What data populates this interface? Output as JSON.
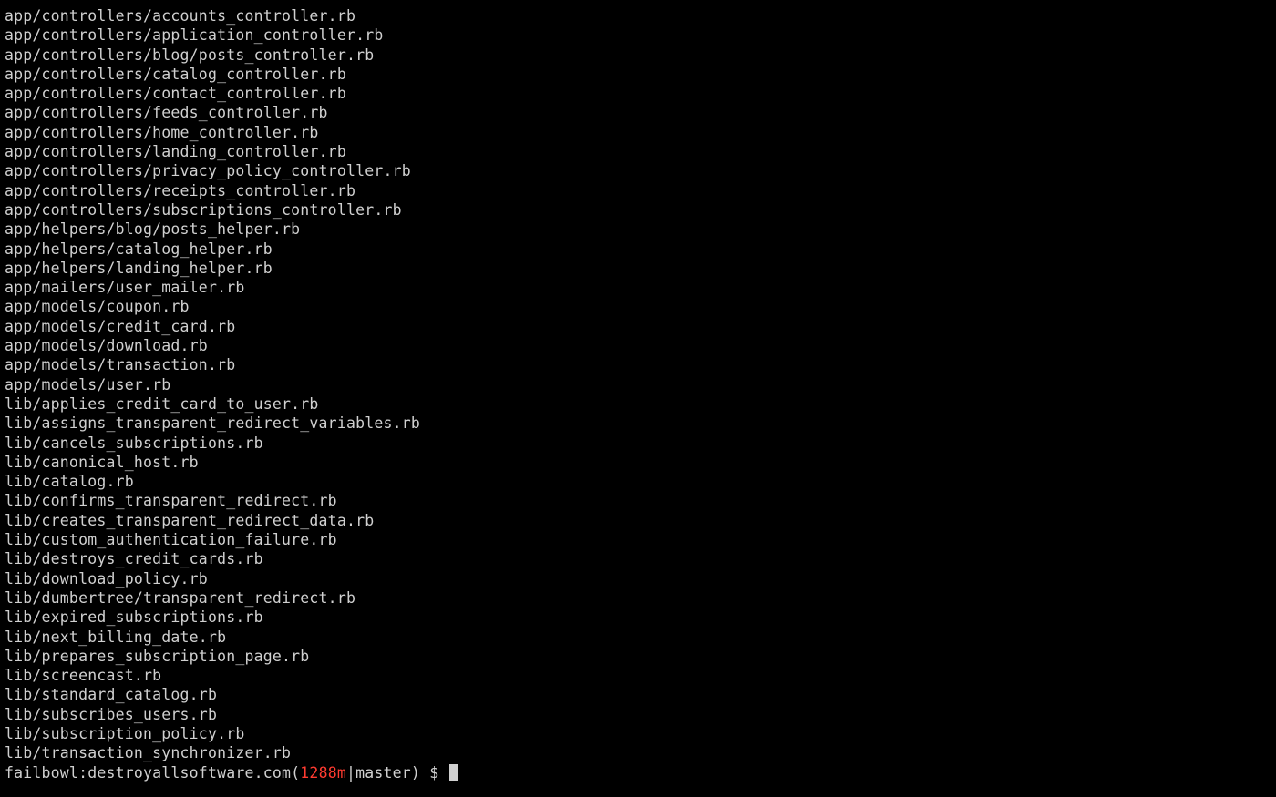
{
  "output_lines": [
    "app/controllers/accounts_controller.rb",
    "app/controllers/application_controller.rb",
    "app/controllers/blog/posts_controller.rb",
    "app/controllers/catalog_controller.rb",
    "app/controllers/contact_controller.rb",
    "app/controllers/feeds_controller.rb",
    "app/controllers/home_controller.rb",
    "app/controllers/landing_controller.rb",
    "app/controllers/privacy_policy_controller.rb",
    "app/controllers/receipts_controller.rb",
    "app/controllers/subscriptions_controller.rb",
    "app/helpers/blog/posts_helper.rb",
    "app/helpers/catalog_helper.rb",
    "app/helpers/landing_helper.rb",
    "app/mailers/user_mailer.rb",
    "app/models/coupon.rb",
    "app/models/credit_card.rb",
    "app/models/download.rb",
    "app/models/transaction.rb",
    "app/models/user.rb",
    "lib/applies_credit_card_to_user.rb",
    "lib/assigns_transparent_redirect_variables.rb",
    "lib/cancels_subscriptions.rb",
    "lib/canonical_host.rb",
    "lib/catalog.rb",
    "lib/confirms_transparent_redirect.rb",
    "lib/creates_transparent_redirect_data.rb",
    "lib/custom_authentication_failure.rb",
    "lib/destroys_credit_cards.rb",
    "lib/download_policy.rb",
    "lib/dumbertree/transparent_redirect.rb",
    "lib/expired_subscriptions.rb",
    "lib/next_billing_date.rb",
    "lib/prepares_subscription_page.rb",
    "lib/screencast.rb",
    "lib/standard_catalog.rb",
    "lib/subscribes_users.rb",
    "lib/subscription_policy.rb",
    "lib/transaction_synchronizer.rb"
  ],
  "prompt": {
    "host_path": "failbowl:destroyallsoftware.com(",
    "time": "1288m",
    "sep": "|",
    "branch": "master",
    "suffix": ") $ "
  }
}
